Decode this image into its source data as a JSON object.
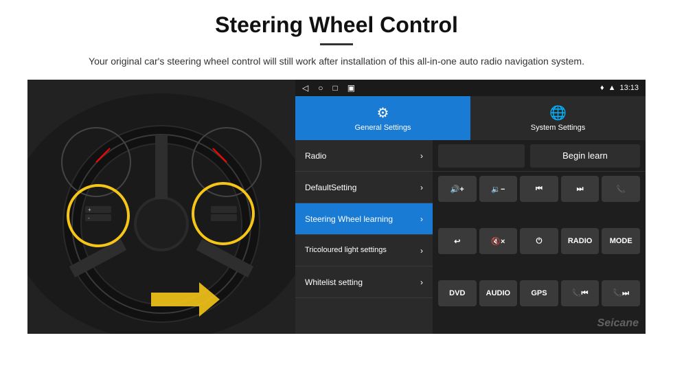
{
  "header": {
    "title": "Steering Wheel Control",
    "subtitle": "Your original car's steering wheel control will still work after installation of this all-in-one auto radio navigation system."
  },
  "status_bar": {
    "time": "13:13",
    "nav_icons": [
      "◁",
      "○",
      "□",
      "▣"
    ]
  },
  "tabs": [
    {
      "id": "general",
      "label": "General Settings",
      "icon": "⚙",
      "active": true
    },
    {
      "id": "system",
      "label": "System Settings",
      "icon": "🌐",
      "active": false
    }
  ],
  "menu_items": [
    {
      "id": "radio",
      "label": "Radio",
      "active": false
    },
    {
      "id": "default",
      "label": "DefaultSetting",
      "active": false
    },
    {
      "id": "steering",
      "label": "Steering Wheel learning",
      "active": true
    },
    {
      "id": "tricoloured",
      "label": "Tricoloured light settings",
      "active": false
    },
    {
      "id": "whitelist",
      "label": "Whitelist setting",
      "active": false
    }
  ],
  "begin_learn_btn": "Begin learn",
  "control_buttons": [
    {
      "id": "vol_up",
      "label": "🔊+",
      "sym": true
    },
    {
      "id": "vol_down",
      "label": "🔉−",
      "sym": true
    },
    {
      "id": "prev",
      "label": "⏮",
      "sym": true
    },
    {
      "id": "next",
      "label": "⏭",
      "sym": true
    },
    {
      "id": "phone",
      "label": "📞",
      "sym": true
    },
    {
      "id": "hang_up",
      "label": "↩",
      "sym": true
    },
    {
      "id": "mute",
      "label": "🔇×",
      "sym": true
    },
    {
      "id": "power",
      "label": "⏻",
      "sym": true
    },
    {
      "id": "radio_btn",
      "label": "RADIO",
      "sym": false
    },
    {
      "id": "mode_btn",
      "label": "MODE",
      "sym": false
    },
    {
      "id": "dvd_btn",
      "label": "DVD",
      "sym": false
    },
    {
      "id": "audio_btn",
      "label": "AUDIO",
      "sym": false
    },
    {
      "id": "gps_btn",
      "label": "GPS",
      "sym": false
    },
    {
      "id": "tel_prev",
      "label": "📞⏮",
      "sym": true
    },
    {
      "id": "tel_next",
      "label": "📞⏭",
      "sym": true
    }
  ],
  "watermark": "Seicane"
}
